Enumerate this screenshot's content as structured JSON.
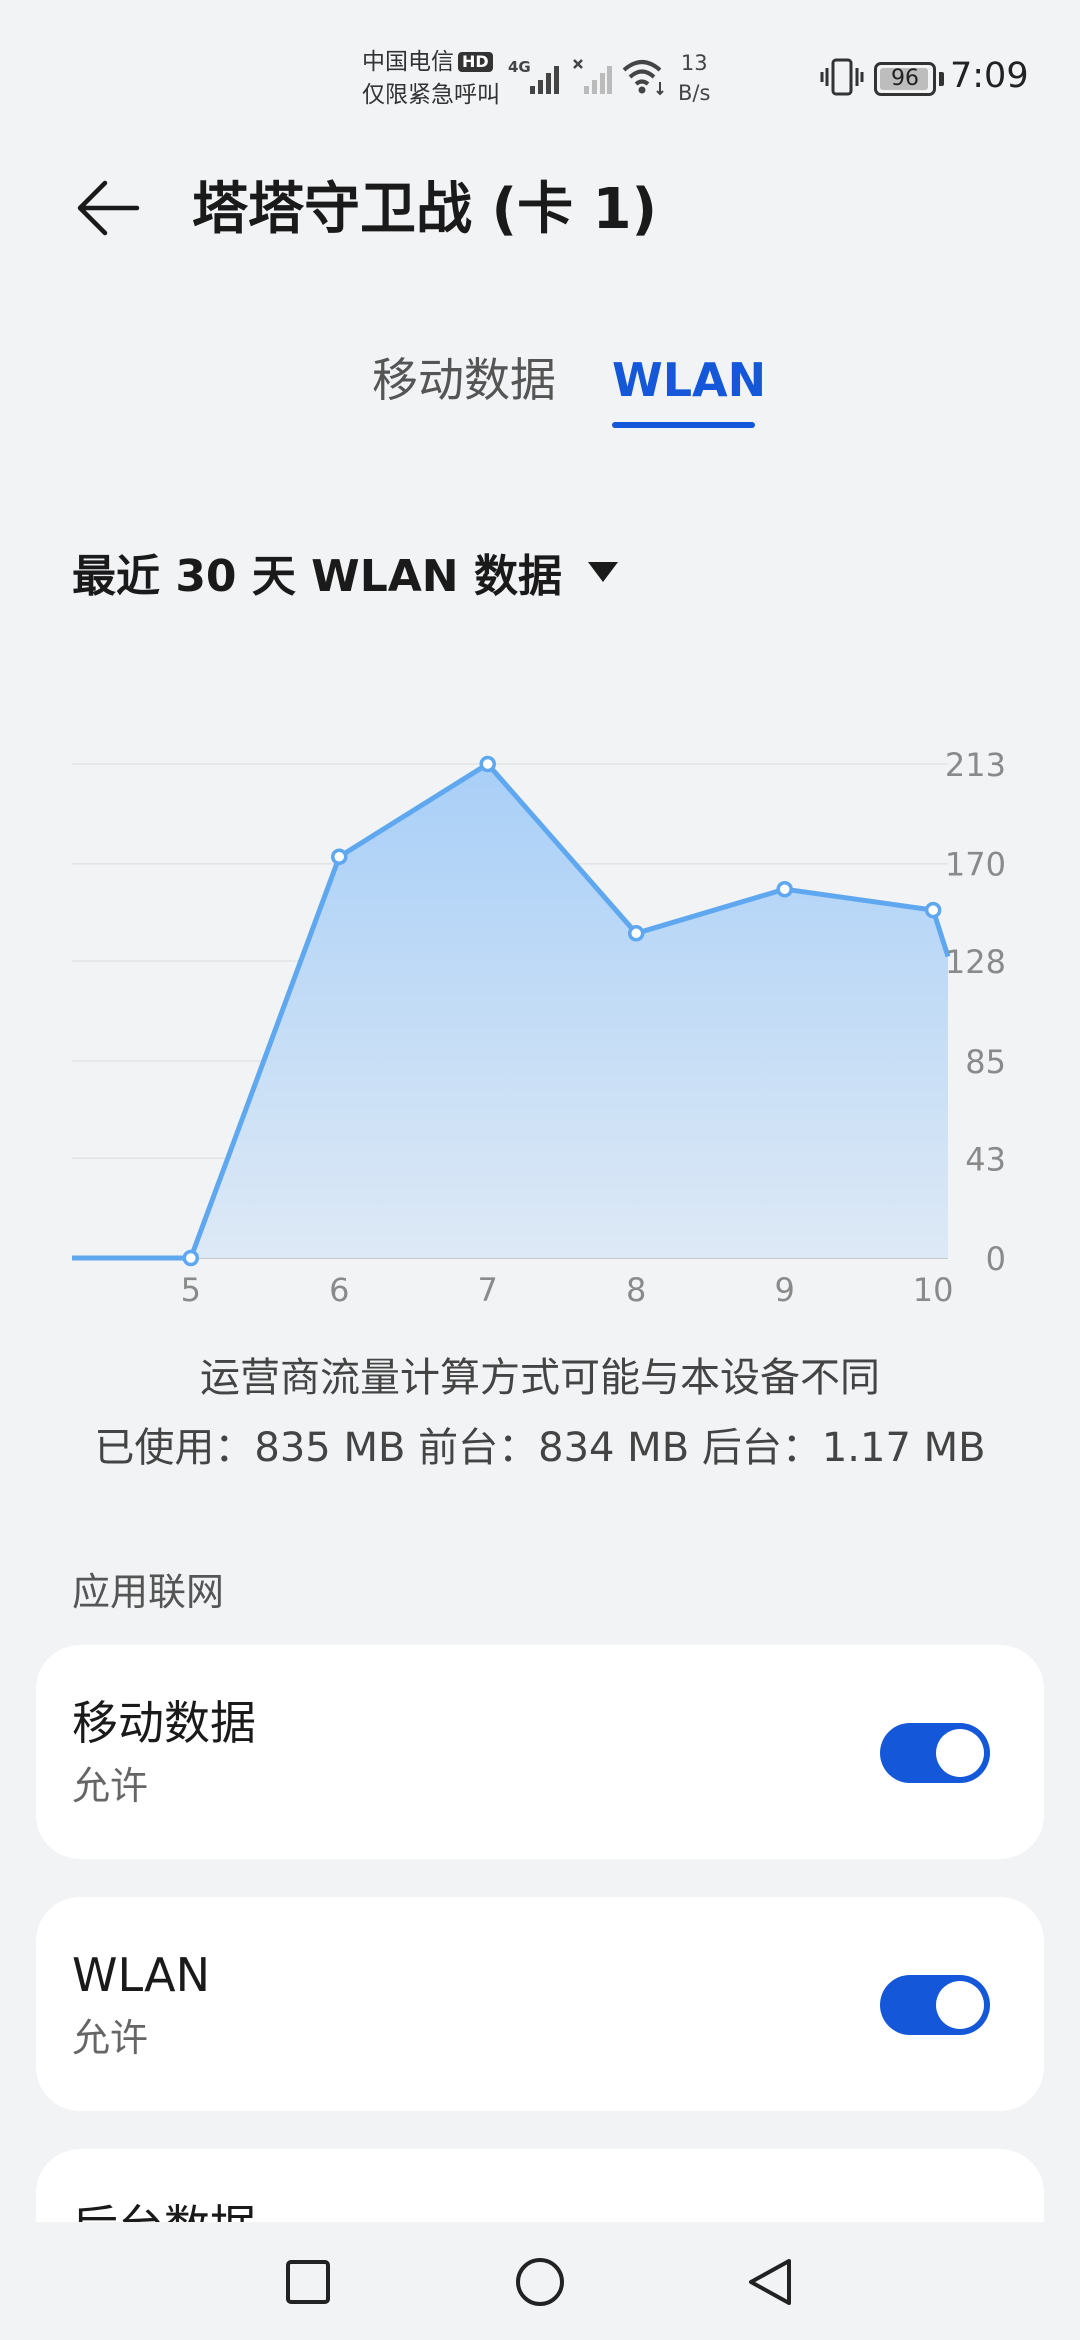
{
  "status_bar": {
    "carrier_line1": "中国电信",
    "hd_badge": "HD",
    "carrier_line2": "仅限紧急呼叫",
    "network_type": "4G",
    "net_speed_value": "13",
    "net_speed_unit": "B/s",
    "battery_level": "96",
    "battery_percent": 96,
    "time": "7:09"
  },
  "header": {
    "title": "塔塔守卫战 (卡 1)"
  },
  "tabs": [
    {
      "label": "移动数据",
      "active": false
    },
    {
      "label": "WLAN",
      "active": true
    }
  ],
  "period_selector": {
    "label": "最近 30 天 WLAN 数据"
  },
  "chart_data": {
    "type": "area",
    "x_ticks": [
      "5",
      "6",
      "7",
      "8",
      "9",
      "10"
    ],
    "x": [
      4.2,
      5,
      6,
      7,
      8,
      9,
      10,
      10.1
    ],
    "values": [
      0,
      0,
      173,
      213,
      140,
      159,
      150,
      130
    ],
    "y_ticks": [
      "0",
      "43",
      "85",
      "128",
      "170",
      "213"
    ],
    "ylim": [
      0,
      213
    ],
    "grid": true,
    "accent_color": "#5fa8f0"
  },
  "info": {
    "note": "运营商流量计算方式可能与本设备不同",
    "usage": "已使用：835 MB 前台：834 MB 后台：1.17 MB"
  },
  "section": {
    "title": "应用联网"
  },
  "settings": [
    {
      "title": "移动数据",
      "subtitle": "允许",
      "enabled": true
    },
    {
      "title": "WLAN",
      "subtitle": "允许",
      "enabled": true
    },
    {
      "title": "后台数据",
      "subtitle": "",
      "enabled": true
    }
  ],
  "colors": {
    "accent": "#1457d8",
    "background": "#f1f3f5"
  }
}
